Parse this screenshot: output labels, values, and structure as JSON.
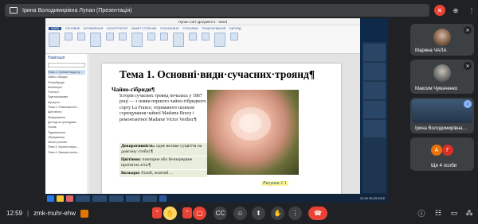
{
  "presenter": {
    "label": "Ірина Володимирівна Лупан (Презентація)"
  },
  "document": {
    "window_title": "Лупан С&Т Документ1 - Word",
    "ribbon_tabs": [
      "ФАЙЛ",
      "ОСНОВНЕ",
      "ВСТАВЛЕННЯ",
      "КОНСТРУКТОР",
      "МАКЕТ СТОРІНКИ",
      "ПОСИЛАННЯ",
      "РОЗСИЛКИ",
      "РЕЦЕНЗУВАННЯ",
      "ВИГЛЯД"
    ],
    "nav_title": "Навігація",
    "nav_items": [
      "Тема 1. Основні види су…",
      "Чайно-гібридні",
      "Флорибунда",
      "Мініатюрні",
      "Плетисті",
      "Ґрунтопокривні",
      "Мускусні",
      "Тема 2. Розмноження…",
      "Щеплення",
      "Живцювання",
      "Догляд за трояндами",
      "Полив",
      "Підживлення",
      "Обрізування",
      "Захист рослин",
      "Тема 3. Корисні вірші…",
      "Тема 4. Використання…"
    ],
    "title": "Тема 1. Основні·види·сучасних·троянд¶",
    "subtitle": "Чайно-гібриди¶",
    "paragraph": "Історія сучасних троянд почалась у 1867 році — з появи першого чайно-гібридного сорту La France, отриманого шляхом схрещування чайної Madame Bravy і ремонтантної Madame Victor Verdier.¶",
    "rows": [
      {
        "label": "Декоративність:",
        "text": "одне велике суцвіття на довгому стеблі.¶"
      },
      {
        "label": "Цвітіння:",
        "text": "повторне або безперервне протягом літа.¶"
      },
      {
        "label": "Кольори:",
        "text": "білий, жовтий…"
      }
    ],
    "caption": "Рисунок·1·1"
  },
  "clock": "12:49 03.03.2022",
  "participants": [
    {
      "name": "Марина ЧАЛА",
      "mic": "off"
    },
    {
      "name": "Максим Чумаченко",
      "mic": "off"
    },
    {
      "name": "Ірина Володимирівна…",
      "mic": "on"
    },
    {
      "name": "Ще 4 особи",
      "initials": [
        "А",
        "Г"
      ]
    }
  ],
  "meeting": {
    "time": "12:59",
    "separator": "|",
    "code": "zmk-muhr-ehw"
  },
  "colors": {
    "background": "#202124",
    "tile": "#3c4043",
    "end_call": "#ea4335",
    "raise_hand": "#fdd663",
    "avatar_orange": "#e8710a",
    "avatar_red": "#d93025"
  }
}
